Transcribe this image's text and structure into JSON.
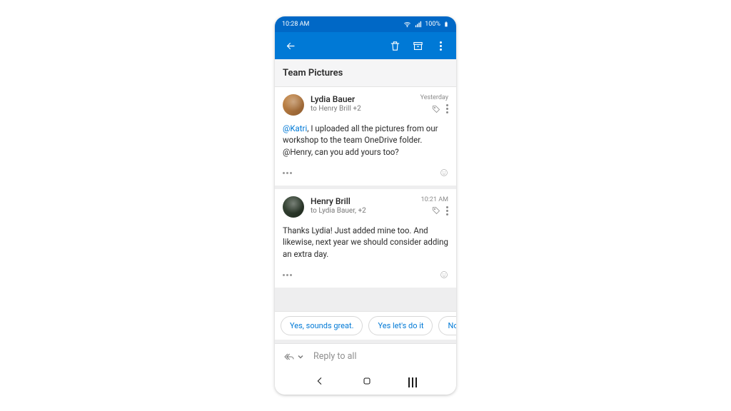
{
  "statusbar": {
    "time": "10:28 AM",
    "battery": "100%"
  },
  "appbar": {},
  "subject": "Team Pictures",
  "messages": [
    {
      "sender": "Lydia Bauer",
      "recipients": "to Henry Brill +2",
      "timestamp": "Yesterday",
      "mention": "@Katri",
      "body_after_mention": ", I uploaded all the pictures from our workshop to the team OneDrive folder. @Henry, can you add yours too?"
    },
    {
      "sender": "Henry Brill",
      "recipients": "to Lydia Bauer, +2",
      "timestamp": "10:21 AM",
      "body": "Thanks Lydia! Just added mine too. And likewise, next year we should consider adding an extra day."
    }
  ],
  "suggestions": [
    "Yes, sounds great.",
    "Yes let's do it",
    "Not this"
  ],
  "reply": {
    "placeholder": "Reply to all"
  }
}
